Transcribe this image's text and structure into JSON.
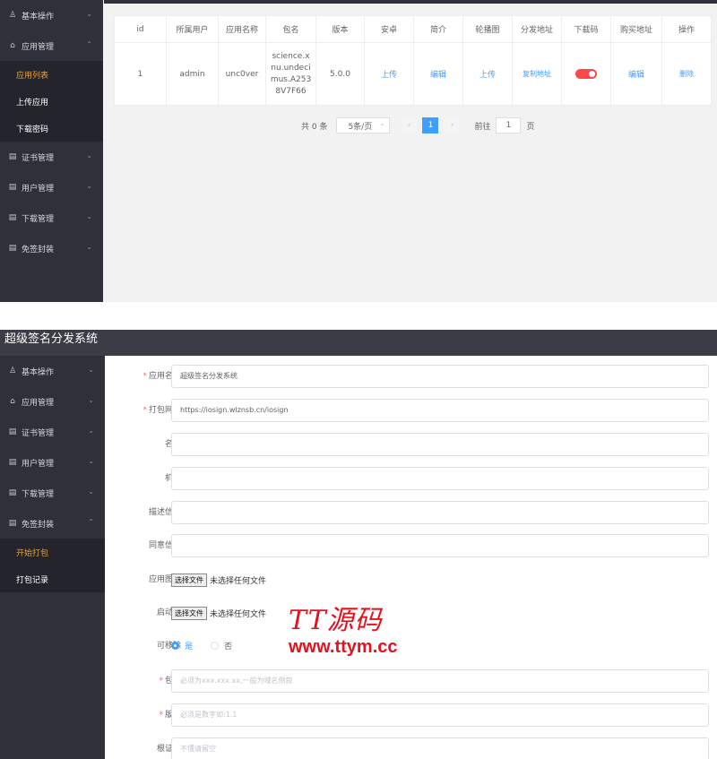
{
  "list_view": {
    "sidebar": {
      "basic_ops": "基本操作",
      "app_mgmt": "应用管理",
      "sub_items": [
        "应用列表",
        "上传应用",
        "下载密码"
      ],
      "cert_mgmt": "证书管理",
      "user_mgmt": "用户管理",
      "download_mgmt": "下载管理",
      "free_sign": "免签封装"
    },
    "table": {
      "headers": [
        "id",
        "所属用户",
        "应用名称",
        "包名",
        "版本",
        "安卓",
        "简介",
        "轮播图",
        "分发地址",
        "下载码",
        "购买地址",
        "操作"
      ],
      "row": {
        "id": "1",
        "user": "admin",
        "app_name": "unc0ver",
        "package": "science.xnu.undecimus.A2538V7F66",
        "version": "5.0.0",
        "android": "上传",
        "intro": "编辑",
        "carousel": "上传",
        "dist": "复制地址",
        "download_code_on": true,
        "buy": "编辑",
        "action": "删除"
      }
    },
    "pager": {
      "total": "共 0 条",
      "page_size": "5条/页",
      "prev": "‹",
      "current": "1",
      "next": "›",
      "goto": "前往",
      "goto_value": "1",
      "page_unit": "页"
    }
  },
  "form_view": {
    "title": "超级签名分发系统",
    "sidebar": {
      "basic_ops": "基本操作",
      "app_mgmt": "应用管理",
      "cert_mgmt": "证书管理",
      "user_mgmt": "用户管理",
      "download_mgmt": "下载管理",
      "free_sign": "免签封装",
      "sub_items": [
        "开始打包",
        "打包记录"
      ]
    },
    "form": {
      "app_name_label": "应用名称",
      "app_name_value": "超级签名分发系统",
      "pack_url_label": "打包网址",
      "pack_url_value": "https://iosign.wlznsb.cn/iosign",
      "name_label": "名称",
      "org_label": "机构",
      "desc_label": "描述信息",
      "consent_label": "同意信息",
      "icon_label": "应用图标",
      "file_btn": "选择文件",
      "no_file": "未选择任何文件",
      "launch_label": "启动图",
      "removable_label": "可移除",
      "yes": "是",
      "no": "否",
      "pkg_label": "包名",
      "pkg_placeholder": "必须为xxx.xxx.xx,一般为域名倒叙",
      "version_label": "版本",
      "version_placeholder": "必须是数字如:1.1",
      "root_cert_label": "根证书",
      "root_cert_placeholder": "不懂请留空"
    }
  },
  "watermark": {
    "line1": "TT源码",
    "line2": "www.ttym.cc"
  },
  "colors": {
    "sidebar_bg": "#2f3039",
    "active_menu": "#e6a23c",
    "link": "#409eff",
    "toggle_on": "#ff4949",
    "watermark": "#e8101c"
  }
}
